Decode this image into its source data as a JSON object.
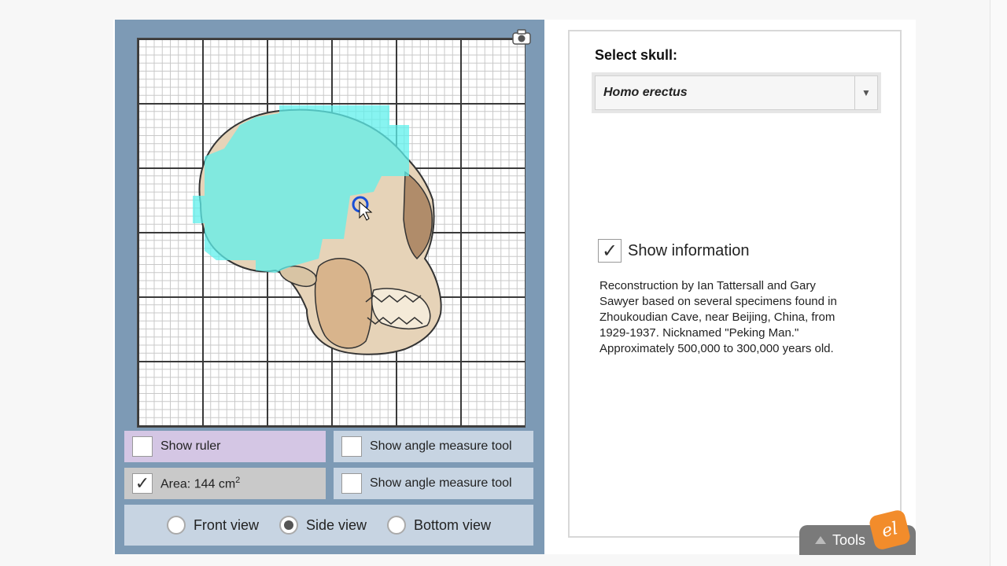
{
  "grid": {
    "camera_icon": "camera-icon",
    "cursor_icon": "mouse-pointer-icon"
  },
  "controls": {
    "show_ruler": {
      "label": "Show ruler",
      "checked": false
    },
    "angle_tool_1": {
      "label": "Show angle measure tool",
      "checked": false
    },
    "area": {
      "label": "Area: 144 cm",
      "superscript": "2",
      "checked": true
    },
    "angle_tool_2": {
      "label": "Show angle measure tool",
      "checked": false
    }
  },
  "views": {
    "front": "Front view",
    "side": "Side view",
    "bottom": "Bottom view",
    "selected": "Side view"
  },
  "right": {
    "select_label": "Select skull:",
    "selected_skull": "Homo erectus",
    "show_information_label": "Show information",
    "show_information_checked": true,
    "info_text": "Reconstruction by Ian Tattersall and Gary Sawyer based on several specimens found in Zhoukoudian Cave, near Beijing, China, from 1929-1937. Nicknamed \"Peking Man.\" Approximately 500,000 to 300,000 years old."
  },
  "tools": {
    "label": "Tools",
    "logo_text": "el"
  },
  "colors": {
    "panel_blue": "#7d9ab5",
    "area_fill": "#5ff0ec",
    "skull_bone": "#e6d3b8",
    "ruler_row": "#d4c6e4",
    "angle_row": "#c7d4e2",
    "tools_orange": "#f28c2b"
  }
}
